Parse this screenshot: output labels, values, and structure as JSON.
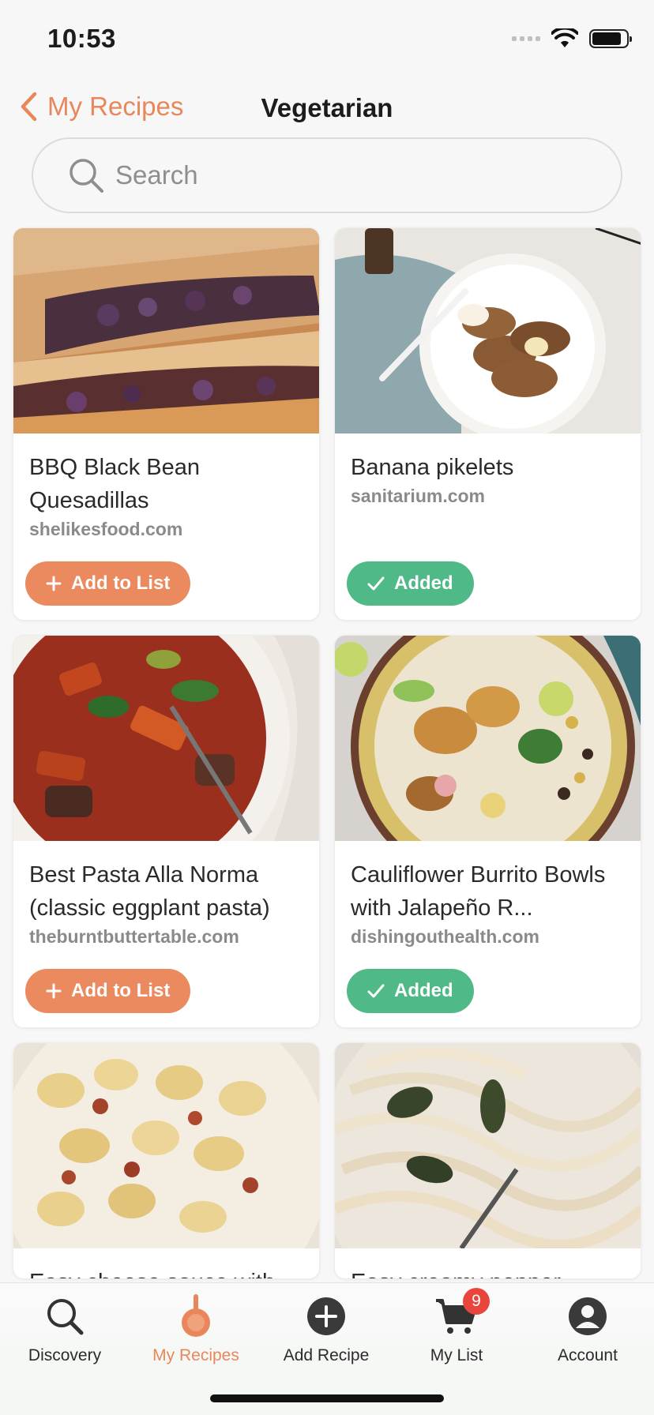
{
  "status": {
    "time": "10:53"
  },
  "header": {
    "back_label": "My Recipes",
    "title": "Vegetarian"
  },
  "search": {
    "placeholder": "Search",
    "value": ""
  },
  "recipes": [
    {
      "title": "BBQ Black Bean Quesadillas",
      "source": "shelikesfood.com",
      "button": "Add to List",
      "state": "add"
    },
    {
      "title": "Banana pikelets",
      "source": "sanitarium.com",
      "button": "Added",
      "state": "added"
    },
    {
      "title": "Best Pasta Alla Norma (classic eggplant pasta)",
      "source": "theburntbuttertable.com",
      "button": "Add to List",
      "state": "add"
    },
    {
      "title": "Cauliflower Burrito Bowls with Jalapeño R...",
      "source": "dishingouthealth.com",
      "button": "Added",
      "state": "added"
    },
    {
      "title": "Easy cheese sauce with",
      "source": "",
      "button": "",
      "state": "partial"
    },
    {
      "title": "Easy creamy pepper",
      "source": "",
      "button": "",
      "state": "partial"
    }
  ],
  "tabbar": {
    "discovery": "Discovery",
    "my_recipes": "My Recipes",
    "add_recipe": "Add Recipe",
    "my_list": "My List",
    "my_list_badge": "9",
    "account": "Account"
  },
  "colors": {
    "accent": "#e8875a",
    "added": "#4fba88",
    "badge": "#e8453c"
  }
}
